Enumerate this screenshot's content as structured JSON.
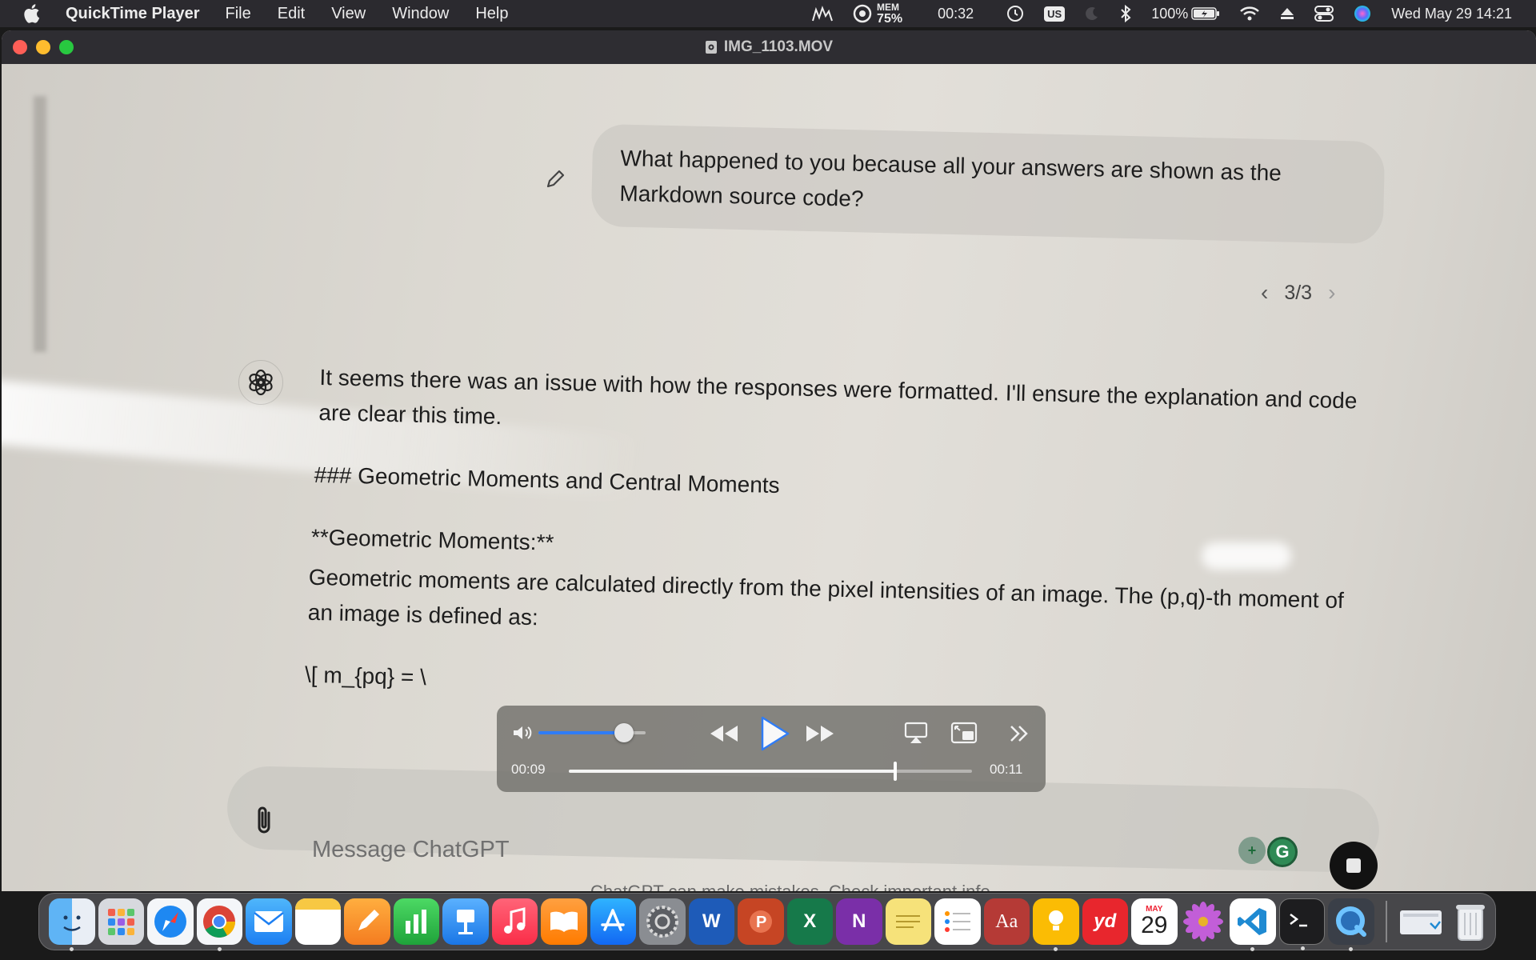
{
  "menubar": {
    "app_name": "QuickTime Player",
    "menus": [
      "File",
      "Edit",
      "View",
      "Window",
      "Help"
    ],
    "status": {
      "mem_label": "MEM",
      "mem_value": "75%",
      "timer": "00:32",
      "input_source": "US",
      "battery": "100%",
      "datetime": "Wed May 29  14:21"
    }
  },
  "window": {
    "title": "IMG_1103.MOV"
  },
  "chat": {
    "user_message": "What happened to you because all your answers are shown as the Markdown source code?",
    "pager": "3/3",
    "assistant": {
      "intro": "It seems there was an issue with how the responses were formatted. I'll ensure the explanation and code are clear this time.",
      "heading": "### Geometric Moments and Central Moments",
      "bold_label": "**Geometric Moments:**",
      "body": "Geometric moments are calculated directly from the pixel intensities of an image. The (p,q)-th moment of an image is defined as:",
      "formula": "\\[ m_{pq} = \\"
    },
    "input_placeholder": "Message ChatGPT",
    "disclaimer": "ChatGPT can make mistakes. Check important info."
  },
  "player": {
    "current_time": "00:09",
    "remaining_time": "00:11",
    "volume": 0.8,
    "progress": 0.81
  },
  "dock": {
    "apps": [
      "finder-icon",
      "launchpad-icon",
      "safari-icon",
      "chrome-icon",
      "mail-icon",
      "notes-icon",
      "pages-icon",
      "numbers-icon",
      "keynote-icon",
      "music-icon",
      "books-icon",
      "app-store-icon",
      "system-settings-icon",
      "word-icon",
      "powerpoint-icon",
      "excel-icon",
      "onenote-icon",
      "stickies-icon",
      "reminders-icon",
      "dictionary-icon",
      "keep-icon",
      "youdao-icon",
      "calendar-icon",
      "flower-icon",
      "vscode-icon",
      "terminal-icon",
      "quicktime-icon"
    ],
    "calendar_month": "MAY",
    "calendar_day": "29",
    "dictionary_label": "Aa",
    "youdao_label": "yd",
    "word_label": "W",
    "excel_label": "X",
    "onenote_label": "N"
  },
  "colors": {
    "accent": "#2f7cf6",
    "menubar": "#2b2a2f"
  }
}
